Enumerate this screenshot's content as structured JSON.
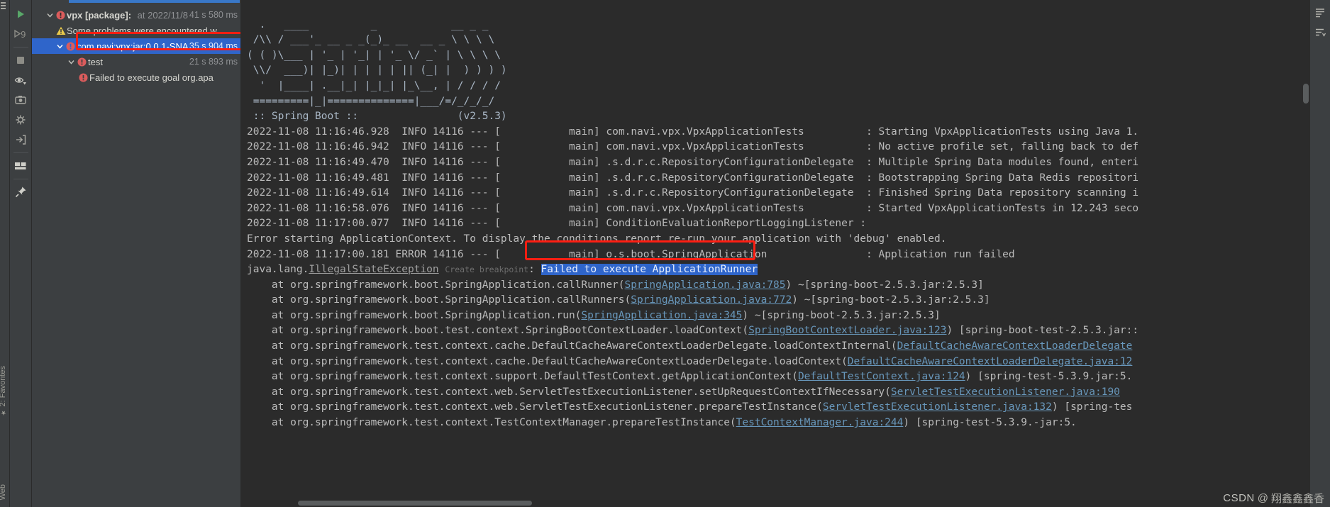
{
  "left_edge": {
    "favorites_label": "2: Favorites",
    "web_label": "Web",
    "star_glyph": "★"
  },
  "toolbar": {
    "items": [
      {
        "name": "rerun-button",
        "label": "Rerun",
        "icon": "play-icon"
      },
      {
        "name": "rerun-failed-tests",
        "label": "Rerun Failed Tests",
        "icon": "rerun-failed-icon"
      },
      {
        "name": "stop-button",
        "label": "Stop",
        "icon": "stop-icon"
      },
      {
        "name": "toggle-auto-test",
        "label": "Toggle auto-test",
        "icon": "eye-icon"
      },
      {
        "name": "export-test-results",
        "label": "Export Test Results",
        "icon": "camera-icon"
      },
      {
        "name": "settings-button",
        "label": "Settings",
        "icon": "gear-bug-icon"
      },
      {
        "name": "scroll-to-stacktrace",
        "label": "Scroll to Stack Trace",
        "icon": "enter-arrow-icon"
      },
      {
        "name": "layout-button",
        "label": "Layout",
        "icon": "layout-icon"
      },
      {
        "name": "pin-tab-button",
        "label": "Pin Tab",
        "icon": "pin-icon"
      }
    ]
  },
  "run_tree": {
    "rows": [
      {
        "indent": 0,
        "chevron": "down",
        "severity": "error",
        "label_bold": "vpx [package]:",
        "label_rest": "at 2022/11/8",
        "time": "41 s 580 ms",
        "selected": false
      },
      {
        "indent": 1,
        "chevron": "none",
        "severity": "warning",
        "label_bold": "",
        "label_rest": "Some problems were encountered w",
        "time": "",
        "selected": false
      },
      {
        "indent": 1,
        "chevron": "down",
        "severity": "error",
        "label_bold": "",
        "label_rest": "com.navi:vpx:jar:0.0.1-SNA",
        "time": "35 s 904 ms",
        "selected": true
      },
      {
        "indent": 2,
        "chevron": "down",
        "severity": "error",
        "label_bold": "",
        "label_rest": "test",
        "time": "21 s 893 ms",
        "selected": false
      },
      {
        "indent": 3,
        "chevron": "none",
        "severity": "error",
        "label_bold": "",
        "label_rest": "Failed to execute goal org.apa",
        "time": "",
        "selected": false
      }
    ]
  },
  "console": {
    "banner": [
      "  .   ____          _            __ _ _",
      " /\\\\ / ___'_ __ _ _(_)_ __  __ _ \\ \\ \\ \\",
      "( ( )\\___ | '_ | '_| | '_ \\/ _` | \\ \\ \\ \\",
      " \\\\/  ___)| |_)| | | | | || (_| |  ) ) ) )",
      "  '  |____| .__|_| |_|_| |_\\__, | / / / /",
      " =========|_|==============|___/=/_/_/_/"
    ],
    "banner_version_line": " :: Spring Boot ::                (v2.5.3)",
    "log_lines": [
      {
        "ts": "2022-11-08 11:16:46.928",
        "level": "INFO",
        "pid": "14116",
        "sep": "---",
        "thread": "main",
        "logger": "com.navi.vpx.VpxApplicationTests",
        "message": "Starting VpxApplicationTests using Java 1."
      },
      {
        "ts": "2022-11-08 11:16:46.942",
        "level": "INFO",
        "pid": "14116",
        "sep": "---",
        "thread": "main",
        "logger": "com.navi.vpx.VpxApplicationTests",
        "message": "No active profile set, falling back to def"
      },
      {
        "ts": "2022-11-08 11:16:49.470",
        "level": "INFO",
        "pid": "14116",
        "sep": "---",
        "thread": "main",
        "logger": ".s.d.r.c.RepositoryConfigurationDelegate",
        "message": "Multiple Spring Data modules found, enteri"
      },
      {
        "ts": "2022-11-08 11:16:49.481",
        "level": "INFO",
        "pid": "14116",
        "sep": "---",
        "thread": "main",
        "logger": ".s.d.r.c.RepositoryConfigurationDelegate",
        "message": "Bootstrapping Spring Data Redis repositori"
      },
      {
        "ts": "2022-11-08 11:16:49.614",
        "level": "INFO",
        "pid": "14116",
        "sep": "---",
        "thread": "main",
        "logger": ".s.d.r.c.RepositoryConfigurationDelegate",
        "message": "Finished Spring Data repository scanning i"
      },
      {
        "ts": "2022-11-08 11:16:58.076",
        "level": "INFO",
        "pid": "14116",
        "sep": "---",
        "thread": "main",
        "logger": "com.navi.vpx.VpxApplicationTests",
        "message": "Started VpxApplicationTests in 12.243 seco"
      },
      {
        "ts": "2022-11-08 11:17:00.077",
        "level": "INFO",
        "pid": "14116",
        "sep": "---",
        "thread": "main",
        "logger": "ConditionEvaluationReportLoggingListener",
        "message": ""
      }
    ],
    "context_error_line": "Error starting ApplicationContext. To display the conditions report re-run your application with 'debug' enabled.",
    "error_log_line": {
      "ts": "2022-11-08 11:17:00.181",
      "level": "ERROR",
      "pid": "14116",
      "sep": "---",
      "thread": "main",
      "logger": "o.s.boot.SpringApplication",
      "message": "Application run failed"
    },
    "exception_line": {
      "prefix": "java.lang.",
      "exception": "IllegalStateException",
      "breakpoint_hint": "Create breakpoint",
      "colon": ": ",
      "highlighted_message": "Failed to execute ApplicationRunner"
    },
    "stack_trace": [
      {
        "pre": "    at org.springframework.boot.SpringApplication.callRunner(",
        "link": "SpringApplication.java:785",
        "post": ") ~[spring-boot-2.5.3.jar:2.5.3]"
      },
      {
        "pre": "    at org.springframework.boot.SpringApplication.callRunners(",
        "link": "SpringApplication.java:772",
        "post": ") ~[spring-boot-2.5.3.jar:2.5.3]"
      },
      {
        "pre": "    at org.springframework.boot.SpringApplication.run(",
        "link": "SpringApplication.java:345",
        "post": ") ~[spring-boot-2.5.3.jar:2.5.3]"
      },
      {
        "pre": "    at org.springframework.boot.test.context.SpringBootContextLoader.loadContext(",
        "link": "SpringBootContextLoader.java:123",
        "post": ") [spring-boot-test-2.5.3.jar::"
      },
      {
        "pre": "    at org.springframework.test.context.cache.DefaultCacheAwareContextLoaderDelegate.loadContextInternal(",
        "link": "DefaultCacheAwareContextLoaderDelegate",
        "post": ""
      },
      {
        "pre": "    at org.springframework.test.context.cache.DefaultCacheAwareContextLoaderDelegate.loadContext(",
        "link": "DefaultCacheAwareContextLoaderDelegate.java:12",
        "post": ""
      },
      {
        "pre": "    at org.springframework.test.context.support.DefaultTestContext.getApplicationContext(",
        "link": "DefaultTestContext.java:124",
        "post": ") [spring-test-5.3.9.jar:5."
      },
      {
        "pre": "    at org.springframework.test.context.web.ServletTestExecutionListener.setUpRequestContextIfNecessary(",
        "link": "ServletTestExecutionListener.java:190",
        "post": ""
      },
      {
        "pre": "    at org.springframework.test.context.web.ServletTestExecutionListener.prepareTestInstance(",
        "link": "ServletTestExecutionListener.java:132",
        "post": ") [spring-tes"
      },
      {
        "pre": "    at org.springframework.test.context.TestContextManager.prepareTestInstance(",
        "link": "TestContextManager.java:244",
        "post": ") [spring-test-5.3.9.-jar:5."
      }
    ]
  },
  "right_gutter": {
    "items": [
      {
        "name": "collapse-all-button",
        "label": "Collapse All",
        "icon": "collapse-lines-icon"
      },
      {
        "name": "sort-alphabetically-button",
        "label": "Sort",
        "icon": "sort-icon"
      }
    ]
  },
  "watermark": {
    "brand": "CSDN",
    "at": "@",
    "author": "翔鑫鑫鑫香"
  },
  "colors": {
    "accent_selection": "#2f65ca",
    "annotation": "#ff1e12",
    "console_bg": "#2b2b2b",
    "panel_bg": "#3c3f41",
    "error_red": "#db5c5c",
    "warn_yellow": "#e8c84b",
    "link_blue": "#6897bb"
  }
}
